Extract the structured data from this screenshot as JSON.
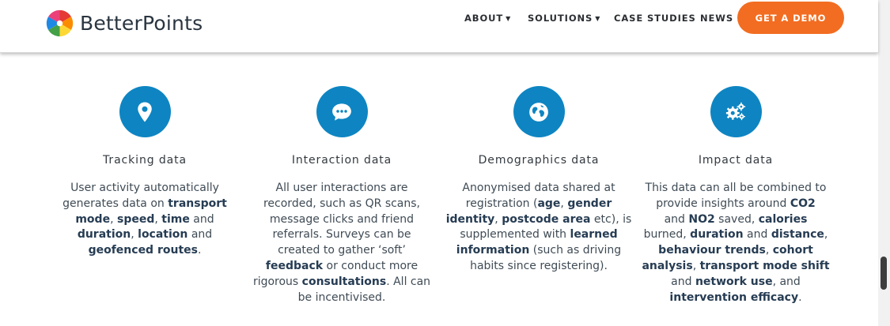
{
  "header": {
    "logo_text": "BetterPoints",
    "nav": [
      {
        "label": "ABOUT",
        "has_caret": true
      },
      {
        "label": "SOLUTIONS",
        "has_caret": true
      },
      {
        "label": "CASE STUDIES",
        "has_caret": false
      },
      {
        "label": "NEWS",
        "has_caret": false
      }
    ],
    "cta_label": "GET A DEMO"
  },
  "colors": {
    "accent_orange": "#f26d21",
    "icon_blue": "#0e85c2",
    "text_dark": "#263c53"
  },
  "features": [
    {
      "icon": "location-pin-icon",
      "title": "Tracking data",
      "body": [
        [
          "User activity automatically",
          false
        ],
        [
          "\n",
          false
        ],
        [
          "generates data on ",
          false
        ],
        [
          "transport",
          true
        ],
        [
          "\n",
          false
        ],
        [
          "mode",
          true
        ],
        [
          ", ",
          false
        ],
        [
          "speed",
          true
        ],
        [
          ", ",
          false
        ],
        [
          "time",
          true
        ],
        [
          " and",
          false
        ],
        [
          "\n",
          false
        ],
        [
          "duration",
          true
        ],
        [
          ", ",
          false
        ],
        [
          "location",
          true
        ],
        [
          " and",
          false
        ],
        [
          "\n",
          false
        ],
        [
          "geofenced routes",
          true
        ],
        [
          ".",
          false
        ]
      ]
    },
    {
      "icon": "chat-bubble-icon",
      "title": "Interaction data",
      "body": [
        [
          "All user interactions are",
          false
        ],
        [
          "\n",
          false
        ],
        [
          "recorded, such as QR scans,",
          false
        ],
        [
          "\n",
          false
        ],
        [
          "message clicks and friend",
          false
        ],
        [
          "\n",
          false
        ],
        [
          "referrals. Surveys can be",
          false
        ],
        [
          "\n",
          false
        ],
        [
          "created to gather ‘soft’",
          false
        ],
        [
          "\n",
          false
        ],
        [
          "feedback",
          true
        ],
        [
          " or conduct more",
          false
        ],
        [
          "\n",
          false
        ],
        [
          "rigorous ",
          false
        ],
        [
          "consultations",
          true
        ],
        [
          ". All can",
          false
        ],
        [
          "\n",
          false
        ],
        [
          "be incentivised.",
          false
        ]
      ]
    },
    {
      "icon": "globe-icon",
      "title": "Demographics data",
      "body": [
        [
          "Anonymised data shared at",
          false
        ],
        [
          "\n",
          false
        ],
        [
          "registration (",
          false
        ],
        [
          "age",
          true
        ],
        [
          ", ",
          false
        ],
        [
          "gender",
          true
        ],
        [
          "\n",
          false
        ],
        [
          "identity",
          true
        ],
        [
          ", ",
          false
        ],
        [
          "postcode area",
          true
        ],
        [
          " etc), is",
          false
        ],
        [
          "\n",
          false
        ],
        [
          "supplemented with ",
          false
        ],
        [
          "learned",
          true
        ],
        [
          "\n",
          false
        ],
        [
          "information",
          true
        ],
        [
          " (such as driving",
          false
        ],
        [
          "\n",
          false
        ],
        [
          "habits since registering).",
          false
        ]
      ]
    },
    {
      "icon": "gears-icon",
      "title": "Impact data",
      "body": [
        [
          "This data can all be combined to",
          false
        ],
        [
          "\n",
          false
        ],
        [
          "provide insights around ",
          false
        ],
        [
          "CO2",
          true
        ],
        [
          "\n",
          false
        ],
        [
          "and ",
          false
        ],
        [
          "NO2",
          true
        ],
        [
          " saved, ",
          false
        ],
        [
          "calories",
          true
        ],
        [
          "\n",
          false
        ],
        [
          "burned, ",
          false
        ],
        [
          "duration",
          true
        ],
        [
          " and ",
          false
        ],
        [
          "distance",
          true
        ],
        [
          ",",
          false
        ],
        [
          "\n",
          false
        ],
        [
          "behaviour trends",
          true
        ],
        [
          ", ",
          false
        ],
        [
          "cohort",
          true
        ],
        [
          "\n",
          false
        ],
        [
          "analysis",
          true
        ],
        [
          ", ",
          false
        ],
        [
          "transport mode shift",
          true
        ],
        [
          "\n",
          false
        ],
        [
          "and ",
          false
        ],
        [
          "network use",
          true
        ],
        [
          ", and",
          false
        ],
        [
          "\n",
          false
        ],
        [
          "intervention efficacy",
          true
        ],
        [
          ".",
          false
        ]
      ]
    }
  ]
}
